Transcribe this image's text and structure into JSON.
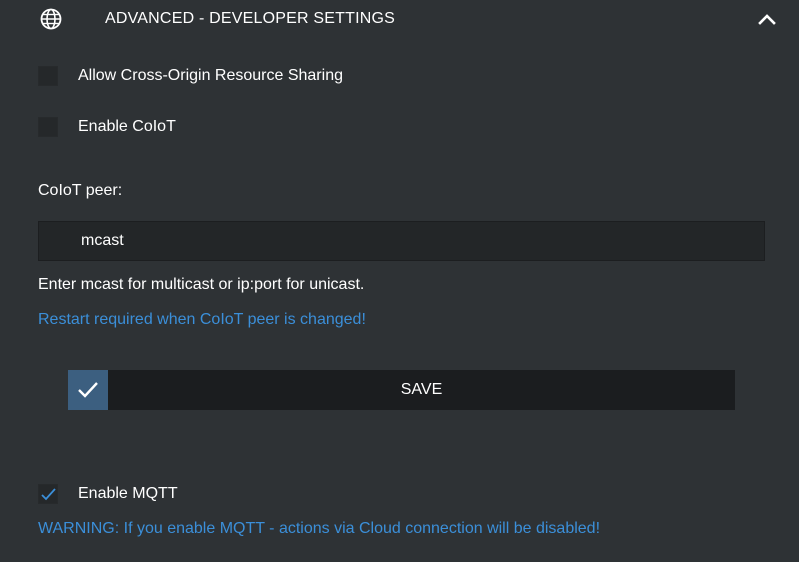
{
  "header": {
    "title": "ADVANCED - DEVELOPER SETTINGS",
    "icon": "globe-icon",
    "toggle_icon": "chevron-up-icon"
  },
  "options": {
    "cors": {
      "label": "Allow Cross-Origin Resource Sharing",
      "checked": false
    },
    "coiot": {
      "label": "Enable CoIoT",
      "checked": false
    },
    "mqtt": {
      "label": "Enable MQTT",
      "checked": true
    }
  },
  "coiot_peer": {
    "label": "CoIoT peer:",
    "value": "mcast",
    "hint": "Enter mcast for multicast or ip:port for unicast.",
    "restart_note": "Restart required when CoIoT peer is changed!"
  },
  "save_button": {
    "label": "SAVE",
    "icon": "checkmark-icon"
  },
  "mqtt_warning": "WARNING: If you enable MQTT - actions via Cloud connection will be disabled!",
  "colors": {
    "background": "#2e3235",
    "accent": "#3c5f80",
    "link": "#3b8fd9"
  }
}
